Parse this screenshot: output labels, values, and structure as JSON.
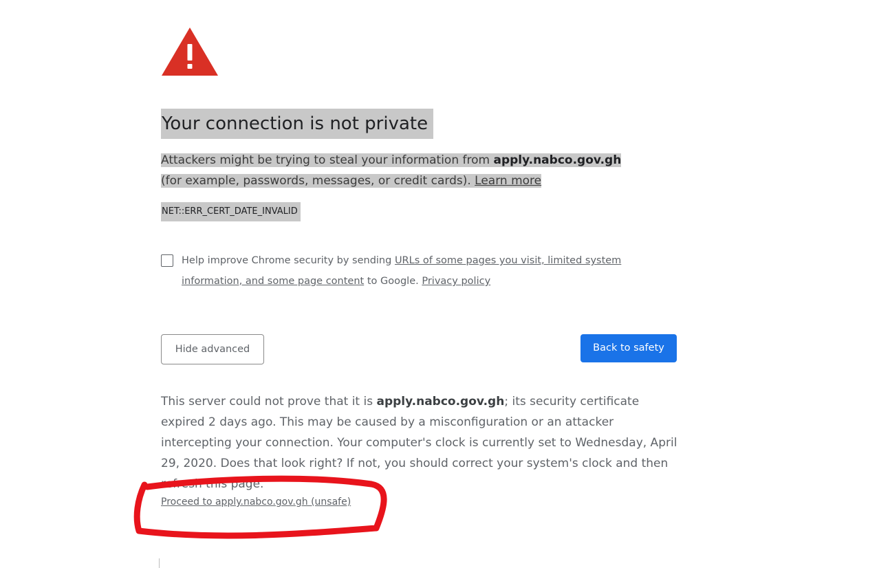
{
  "interstitial": {
    "title": "Your connection is not private",
    "intro_prefix": "Attackers might be trying to steal your information from ",
    "host": "apply.nabco.gov.gh",
    "intro_middle": " (for example, passwords, messages, or credit cards). ",
    "learn_more": "Learn more",
    "error_code": "NET::ERR_CERT_DATE_INVALID",
    "optin": {
      "text_prefix": "Help improve Chrome security by sending ",
      "link_urls": "URLs of some pages you visit, limited system information, and some page content",
      "text_middle": " to Google. ",
      "link_privacy": "Privacy policy",
      "checked": false
    },
    "buttons": {
      "hide_advanced": "Hide advanced",
      "back_to_safety": "Back to safety"
    },
    "details": {
      "prefix": "This server could not prove that it is ",
      "host": "apply.nabco.gov.gh",
      "suffix": "; its security certificate expired 2 days ago. This may be caused by a misconfiguration or an attacker intercepting your connection. Your computer's clock is currently set to Wednesday, April 29, 2020. Does that look right? If not, you should correct your system's clock and then refresh this page."
    },
    "proceed_link": "Proceed to apply.nabco.gov.gh (unsafe)"
  },
  "icons": {
    "warning": "warning-triangle-icon"
  },
  "colors": {
    "warning_red": "#d93025",
    "primary_blue": "#1a73e8",
    "highlight": "#c8c8c8",
    "annotation_red": "#e8141c"
  }
}
